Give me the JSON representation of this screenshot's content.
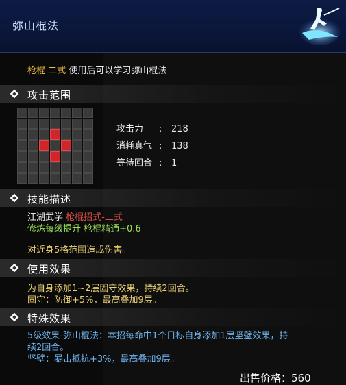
{
  "title": "弥山棍法",
  "desc": {
    "weapon": "枪棍",
    "rank": "二式",
    "text": "使用后可以学习弥山棍法"
  },
  "sections": {
    "range": "攻击范围",
    "skill_desc": "技能描述",
    "use_effect": "使用效果",
    "special_effect": "特殊效果"
  },
  "range_grid": {
    "size": 7,
    "active_cells": [
      [
        2,
        3
      ],
      [
        3,
        2
      ],
      [
        3,
        4
      ],
      [
        4,
        3
      ]
    ]
  },
  "stats": {
    "attack_label": "攻击力",
    "attack_value": "218",
    "mp_label": "消耗真气",
    "mp_value": "138",
    "wait_label": "等待回合",
    "wait_value": "1",
    "colon": ":"
  },
  "skill_desc": {
    "line1_prefix": "江湖武学",
    "line1_red": "枪棍招式-二式",
    "line2": "修炼每级提升 枪棍精通+0.6",
    "line3": "对近身5格范围造成伤害。"
  },
  "use_effect": {
    "line1": "为自身添加1~2层固守效果，持续2回合。",
    "line2": "固守：防御+5%，最高叠加9层。"
  },
  "special_effect": {
    "line1": "5级效果-弥山棍法：本招每命中1个目标自身添加1层坚壁效果，持",
    "line2": "续2回合。",
    "line3": "坚壁：暴击抵抗+3%，最高叠加9层。"
  },
  "price": {
    "label": "出售价格：",
    "value": "560"
  },
  "colors": {
    "header": "#0d1b45",
    "range_active": "#d0262b",
    "gold": "#f0c040",
    "green": "#9be05a",
    "blue": "#6fb4f0"
  },
  "icons": [
    "diamond-icon",
    "swordsman-emblem-icon"
  ]
}
